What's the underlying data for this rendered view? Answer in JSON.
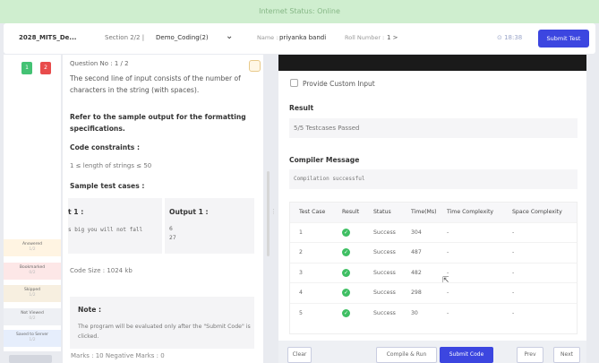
{
  "status": {
    "text": "Internet Status: Online"
  },
  "header": {
    "test_name": "2028_MITS_De...",
    "section": "Section 2/2 |",
    "coding_select": "Demo_Coding(2)",
    "chevron": "⌄",
    "name_label": "Name :",
    "name_value": "priyanka bandi",
    "roll_label": "Roll Number :",
    "roll_value": "1 >",
    "timer": "⊙ 18:38",
    "submit_label": "Submit Test"
  },
  "rail": {
    "questions": [
      "1",
      "2"
    ],
    "legend": [
      {
        "label": "Answered",
        "count": "1/2"
      },
      {
        "label": "Bookmarked",
        "count": "0/2"
      },
      {
        "label": "Skipped",
        "count": "1/2"
      },
      {
        "label": "Not Viewed",
        "count": "0/2"
      },
      {
        "label": "Saved to Server",
        "count": "1/2"
      }
    ]
  },
  "question": {
    "number": "Question No : 1 / 2",
    "text": "The second line of input consists of the number of characters in the string (with spaces).",
    "refer": "Refer to the sample output for the formatting specifications.",
    "constraints_title": "Code constraints :",
    "constraints_text": "1 ≤ length of strings ≤ 50",
    "sample_title": "Sample test cases :",
    "input_heading": "t 1 :",
    "input_code": "s big you will not fall",
    "output_heading": "Output 1 :",
    "output_lines": [
      "6",
      "27"
    ],
    "code_size": "Code Size : 1024 kb",
    "note_title": "Note :",
    "note_text": "The program will be evaluated only after the \"Submit Code\" is clicked."
  },
  "marks": {
    "text": "Marks : 10   Negative Marks : 0"
  },
  "right": {
    "custom_input_label": "Provide Custom Input",
    "result_title": "Result",
    "result_text": "5/5 Testcases Passed",
    "compiler_title": "Compiler Message",
    "compiler_text": "Compilation successful",
    "table_headers": [
      "Test Case",
      "Result",
      "Status",
      "Time(Ms)",
      "Time Complexity",
      "Space Complexity"
    ],
    "rows": [
      {
        "case": "1",
        "status": "Success",
        "time": "304",
        "tc": "-",
        "sc": "-"
      },
      {
        "case": "2",
        "status": "Success",
        "time": "487",
        "tc": "-",
        "sc": "-"
      },
      {
        "case": "3",
        "status": "Success",
        "time": "482",
        "tc": "-",
        "sc": "-"
      },
      {
        "case": "4",
        "status": "Success",
        "time": "298",
        "tc": "-",
        "sc": "-"
      },
      {
        "case": "5",
        "status": "Success",
        "time": "30",
        "tc": "-",
        "sc": "-"
      }
    ],
    "buttons": {
      "clear": "Clear",
      "compile_run": "Compile & Run",
      "submit_code": "Submit Code",
      "prev": "Prev",
      "next": "Next"
    }
  }
}
